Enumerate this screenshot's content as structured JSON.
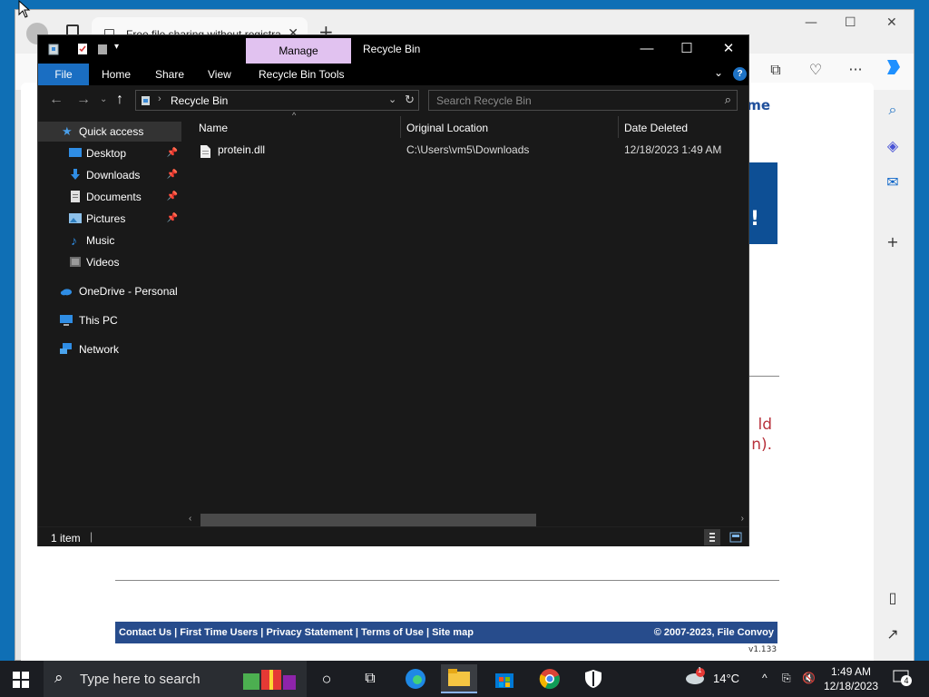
{
  "browser": {
    "tab_title": "Free file sharing without registration",
    "page": {
      "home_link": "ome",
      "banner_fragment": "!",
      "red_text_lines": [
        "ld",
        "n)."
      ],
      "footer_links": [
        "Contact Us",
        "First Time Users",
        "Privacy Statement",
        "Terms of Use",
        "Site map"
      ],
      "footer_links_text": "Contact Us | First Time Users | Privacy Statement | Terms of Use | Site map",
      "footer_copyright": "© 2007-2023, File Convoy",
      "version": "v1.133"
    }
  },
  "explorer": {
    "title": "Recycle Bin",
    "manage_label": "Manage",
    "ribbon": {
      "file": "File",
      "home": "Home",
      "share": "Share",
      "view": "View",
      "tools": "Recycle Bin Tools",
      "help": "?"
    },
    "address": "Recycle Bin",
    "search_placeholder": "Search Recycle Bin",
    "nav": {
      "quick_access": "Quick access",
      "desktop": "Desktop",
      "downloads": "Downloads",
      "documents": "Documents",
      "pictures": "Pictures",
      "music": "Music",
      "videos": "Videos",
      "onedrive": "OneDrive - Personal",
      "this_pc": "This PC",
      "network": "Network"
    },
    "columns": {
      "name": "Name",
      "location": "Original Location",
      "date": "Date Deleted"
    },
    "files": [
      {
        "name": "protein.dll",
        "location": "C:\\Users\\vm5\\Downloads",
        "date": "12/18/2023 1:49 AM"
      }
    ],
    "status": "1 item"
  },
  "taskbar": {
    "search_placeholder": "Type here to search",
    "weather": "14°C",
    "time": "1:49 AM",
    "date": "12/18/2023",
    "notification_count": "4",
    "weather_badge": "1"
  },
  "colors": {
    "manage_tab": "#e1c2f0",
    "file_tab": "#1a6ec2",
    "footer_bar": "#274c8c",
    "red_text": "#b8323c"
  }
}
